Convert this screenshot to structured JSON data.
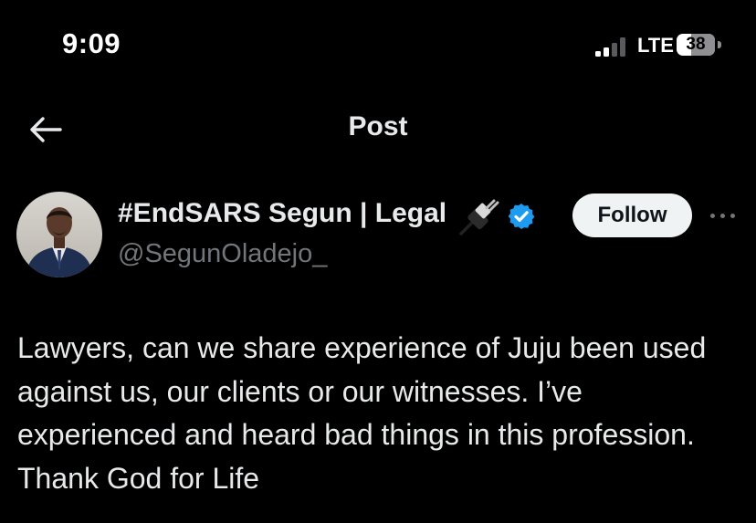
{
  "status_bar": {
    "time": "9:09",
    "network": "LTE",
    "battery": "38",
    "battery_level": 0.38,
    "signal_bars_active": 2,
    "signal_bars_total": 4
  },
  "header": {
    "title": "Post",
    "back_icon": "arrow-left-icon"
  },
  "post": {
    "author": {
      "display_name": "#EndSARS Segun | Legal",
      "name_emoji_icon": "electric-plug-icon",
      "verified_icon": "verified-badge-icon",
      "handle": "@SegunOladejo_"
    },
    "follow_label": "Follow",
    "more_icon": "more-horizontal-icon",
    "text": "Lawyers, can we share experience of Juju been used against us, our clients or our witnesses. I’ve experienced and heard bad things in this profession. Thank God for Life"
  },
  "colors": {
    "background": "#000000",
    "text_primary": "#e7e9ea",
    "text_secondary": "#71767b",
    "verified_blue": "#1d9bf0",
    "follow_button_bg": "#eff3f4",
    "follow_button_text": "#0f1419"
  }
}
